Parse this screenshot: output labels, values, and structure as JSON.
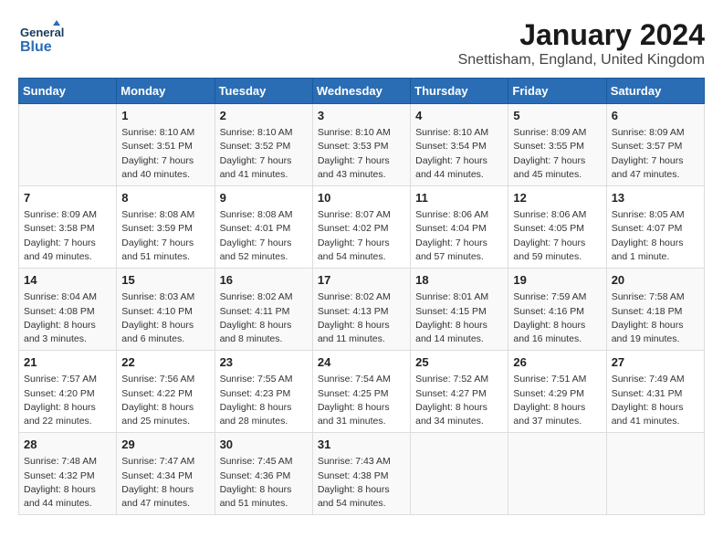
{
  "logo": {
    "general": "General",
    "blue": "Blue"
  },
  "title": "January 2024",
  "subtitle": "Snettisham, England, United Kingdom",
  "days_header": [
    "Sunday",
    "Monday",
    "Tuesday",
    "Wednesday",
    "Thursday",
    "Friday",
    "Saturday"
  ],
  "weeks": [
    [
      {
        "num": "",
        "text": ""
      },
      {
        "num": "1",
        "text": "Sunrise: 8:10 AM\nSunset: 3:51 PM\nDaylight: 7 hours\nand 40 minutes."
      },
      {
        "num": "2",
        "text": "Sunrise: 8:10 AM\nSunset: 3:52 PM\nDaylight: 7 hours\nand 41 minutes."
      },
      {
        "num": "3",
        "text": "Sunrise: 8:10 AM\nSunset: 3:53 PM\nDaylight: 7 hours\nand 43 minutes."
      },
      {
        "num": "4",
        "text": "Sunrise: 8:10 AM\nSunset: 3:54 PM\nDaylight: 7 hours\nand 44 minutes."
      },
      {
        "num": "5",
        "text": "Sunrise: 8:09 AM\nSunset: 3:55 PM\nDaylight: 7 hours\nand 45 minutes."
      },
      {
        "num": "6",
        "text": "Sunrise: 8:09 AM\nSunset: 3:57 PM\nDaylight: 7 hours\nand 47 minutes."
      }
    ],
    [
      {
        "num": "7",
        "text": "Sunrise: 8:09 AM\nSunset: 3:58 PM\nDaylight: 7 hours\nand 49 minutes."
      },
      {
        "num": "8",
        "text": "Sunrise: 8:08 AM\nSunset: 3:59 PM\nDaylight: 7 hours\nand 51 minutes."
      },
      {
        "num": "9",
        "text": "Sunrise: 8:08 AM\nSunset: 4:01 PM\nDaylight: 7 hours\nand 52 minutes."
      },
      {
        "num": "10",
        "text": "Sunrise: 8:07 AM\nSunset: 4:02 PM\nDaylight: 7 hours\nand 54 minutes."
      },
      {
        "num": "11",
        "text": "Sunrise: 8:06 AM\nSunset: 4:04 PM\nDaylight: 7 hours\nand 57 minutes."
      },
      {
        "num": "12",
        "text": "Sunrise: 8:06 AM\nSunset: 4:05 PM\nDaylight: 7 hours\nand 59 minutes."
      },
      {
        "num": "13",
        "text": "Sunrise: 8:05 AM\nSunset: 4:07 PM\nDaylight: 8 hours\nand 1 minute."
      }
    ],
    [
      {
        "num": "14",
        "text": "Sunrise: 8:04 AM\nSunset: 4:08 PM\nDaylight: 8 hours\nand 3 minutes."
      },
      {
        "num": "15",
        "text": "Sunrise: 8:03 AM\nSunset: 4:10 PM\nDaylight: 8 hours\nand 6 minutes."
      },
      {
        "num": "16",
        "text": "Sunrise: 8:02 AM\nSunset: 4:11 PM\nDaylight: 8 hours\nand 8 minutes."
      },
      {
        "num": "17",
        "text": "Sunrise: 8:02 AM\nSunset: 4:13 PM\nDaylight: 8 hours\nand 11 minutes."
      },
      {
        "num": "18",
        "text": "Sunrise: 8:01 AM\nSunset: 4:15 PM\nDaylight: 8 hours\nand 14 minutes."
      },
      {
        "num": "19",
        "text": "Sunrise: 7:59 AM\nSunset: 4:16 PM\nDaylight: 8 hours\nand 16 minutes."
      },
      {
        "num": "20",
        "text": "Sunrise: 7:58 AM\nSunset: 4:18 PM\nDaylight: 8 hours\nand 19 minutes."
      }
    ],
    [
      {
        "num": "21",
        "text": "Sunrise: 7:57 AM\nSunset: 4:20 PM\nDaylight: 8 hours\nand 22 minutes."
      },
      {
        "num": "22",
        "text": "Sunrise: 7:56 AM\nSunset: 4:22 PM\nDaylight: 8 hours\nand 25 minutes."
      },
      {
        "num": "23",
        "text": "Sunrise: 7:55 AM\nSunset: 4:23 PM\nDaylight: 8 hours\nand 28 minutes."
      },
      {
        "num": "24",
        "text": "Sunrise: 7:54 AM\nSunset: 4:25 PM\nDaylight: 8 hours\nand 31 minutes."
      },
      {
        "num": "25",
        "text": "Sunrise: 7:52 AM\nSunset: 4:27 PM\nDaylight: 8 hours\nand 34 minutes."
      },
      {
        "num": "26",
        "text": "Sunrise: 7:51 AM\nSunset: 4:29 PM\nDaylight: 8 hours\nand 37 minutes."
      },
      {
        "num": "27",
        "text": "Sunrise: 7:49 AM\nSunset: 4:31 PM\nDaylight: 8 hours\nand 41 minutes."
      }
    ],
    [
      {
        "num": "28",
        "text": "Sunrise: 7:48 AM\nSunset: 4:32 PM\nDaylight: 8 hours\nand 44 minutes."
      },
      {
        "num": "29",
        "text": "Sunrise: 7:47 AM\nSunset: 4:34 PM\nDaylight: 8 hours\nand 47 minutes."
      },
      {
        "num": "30",
        "text": "Sunrise: 7:45 AM\nSunset: 4:36 PM\nDaylight: 8 hours\nand 51 minutes."
      },
      {
        "num": "31",
        "text": "Sunrise: 7:43 AM\nSunset: 4:38 PM\nDaylight: 8 hours\nand 54 minutes."
      },
      {
        "num": "",
        "text": ""
      },
      {
        "num": "",
        "text": ""
      },
      {
        "num": "",
        "text": ""
      }
    ]
  ]
}
